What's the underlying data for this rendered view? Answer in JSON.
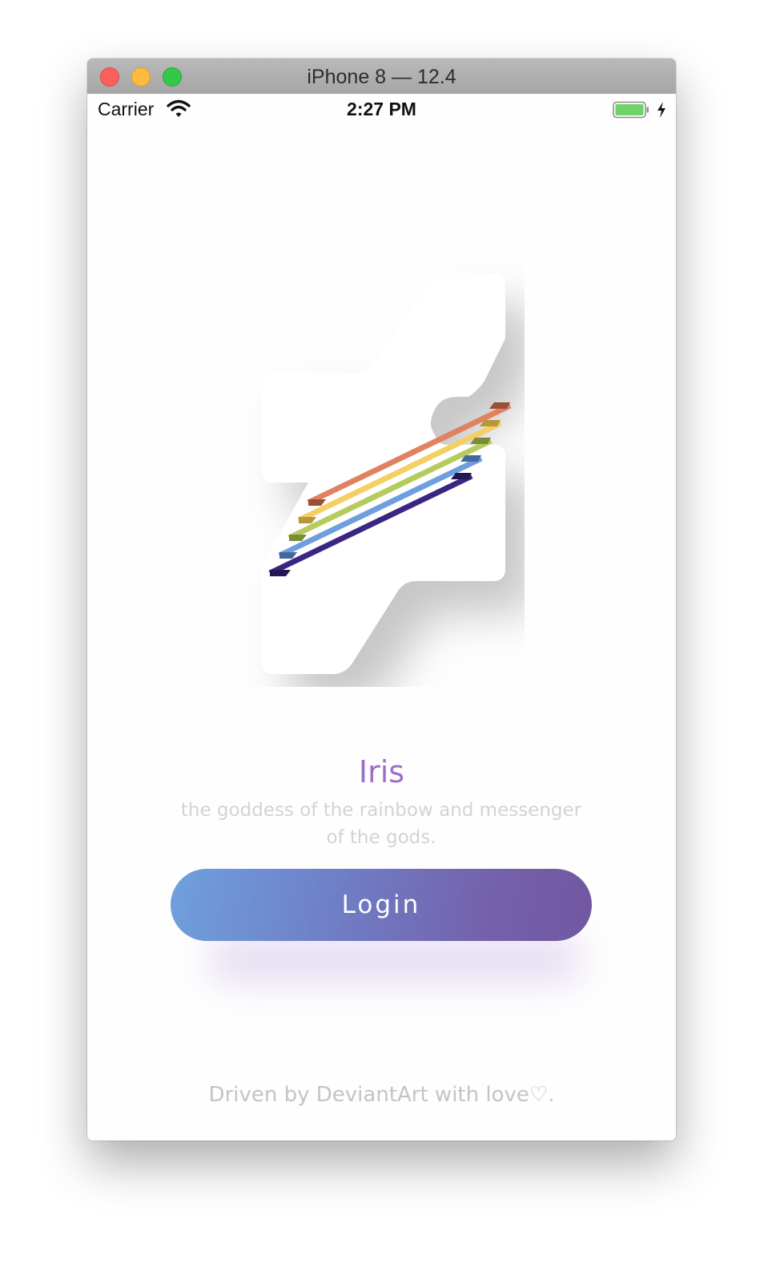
{
  "window": {
    "title": "iPhone 8 — 12.4"
  },
  "statusbar": {
    "carrier": "Carrier",
    "time": "2:27 PM",
    "battery_color": "#6fd36a"
  },
  "app": {
    "title": "Iris",
    "subtitle": "the goddess of the rainbow and messenger of the gods.",
    "login_label": "Login",
    "footer": "Driven by DeviantArt with love♡.",
    "accent_color": "#9b6fc8",
    "login_gradient": [
      "#6fa0de",
      "#7257a1"
    ],
    "logo_icon": "deviantart-logo-icon",
    "rainbow_colors": [
      "#e08262",
      "#f5cf63",
      "#b5cc5d",
      "#6f9ee0",
      "#3a2582"
    ]
  }
}
